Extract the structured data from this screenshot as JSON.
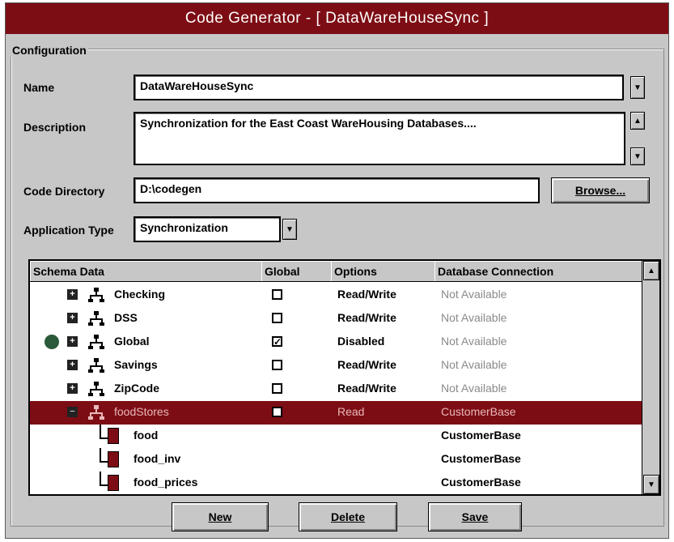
{
  "window": {
    "title": "Code Generator - [ DataWareHouseSync ]"
  },
  "config": {
    "group_label": "Configuration",
    "name_label": "Name",
    "name_value": "DataWareHouseSync",
    "description_label": "Description",
    "description_value": "Synchronization for the East Coast WareHousing Databases....",
    "code_dir_label": "Code Directory",
    "code_dir_value": "D:\\codegen",
    "browse_label": "Browse...",
    "app_type_label": "Application Type",
    "app_type_value": "Synchronization"
  },
  "grid": {
    "columns": [
      "Schema Data",
      "Global",
      "Options",
      "Database Connection"
    ],
    "rows": [
      {
        "name": "Checking",
        "global": "",
        "options": "Read/Write",
        "connection": "Not Available",
        "kind": "schema",
        "expander": "+"
      },
      {
        "name": "DSS",
        "global": "",
        "options": "Read/Write",
        "connection": "Not Available",
        "kind": "schema",
        "expander": "+"
      },
      {
        "name": "Global",
        "global": "✓",
        "options": "Disabled",
        "connection": "Not Available",
        "kind": "schema",
        "expander": "+"
      },
      {
        "name": "Savings",
        "global": "",
        "options": "Read/Write",
        "connection": "Not Available",
        "kind": "schema",
        "expander": "+"
      },
      {
        "name": "ZipCode",
        "global": "",
        "options": "Read/Write",
        "connection": "Not Available",
        "kind": "schema",
        "expander": "+"
      },
      {
        "name": "foodStores",
        "global": "",
        "options": "Read",
        "connection": "CustomerBase",
        "kind": "schema",
        "expander": "−",
        "selected": true
      },
      {
        "name": "food",
        "global": "",
        "options": "",
        "connection": "CustomerBase",
        "kind": "table"
      },
      {
        "name": "food_inv",
        "global": "",
        "options": "",
        "connection": "CustomerBase",
        "kind": "table"
      },
      {
        "name": "food_prices",
        "global": "",
        "options": "",
        "connection": "CustomerBase",
        "kind": "table"
      }
    ]
  },
  "buttons": {
    "new_label": "New",
    "delete_label": "Delete",
    "save_label": "Save"
  },
  "colors": {
    "titlebar": "#7d0d14",
    "face": "#c7c7c7",
    "selection": "#7d0d14"
  }
}
